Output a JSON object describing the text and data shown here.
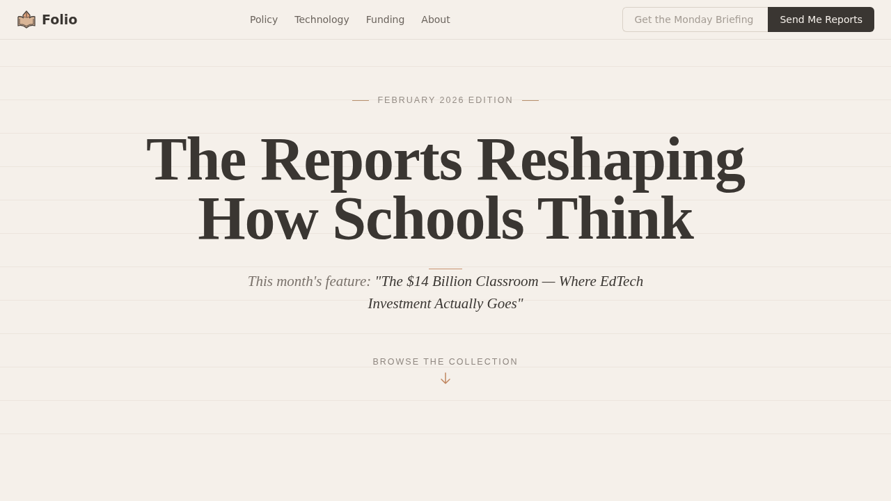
{
  "header": {
    "logo": {
      "name": "Folio"
    },
    "nav": [
      {
        "label": "Policy"
      },
      {
        "label": "Technology"
      },
      {
        "label": "Funding"
      },
      {
        "label": "About"
      }
    ],
    "signup": {
      "placeholder": "Get the Monday Briefing",
      "button": "Send Me Reports"
    }
  },
  "hero": {
    "edition": "FEBRUARY 2026 EDITION",
    "heading_lines": [
      "The Reports Reshaping",
      "How Schools Think"
    ],
    "feature": {
      "label": "This month's feature:",
      "title": "\"The $14 Billion Classroom — Where EdTech Investment Actually Goes\""
    },
    "browse": "BROWSE THE COLLECTION"
  }
}
